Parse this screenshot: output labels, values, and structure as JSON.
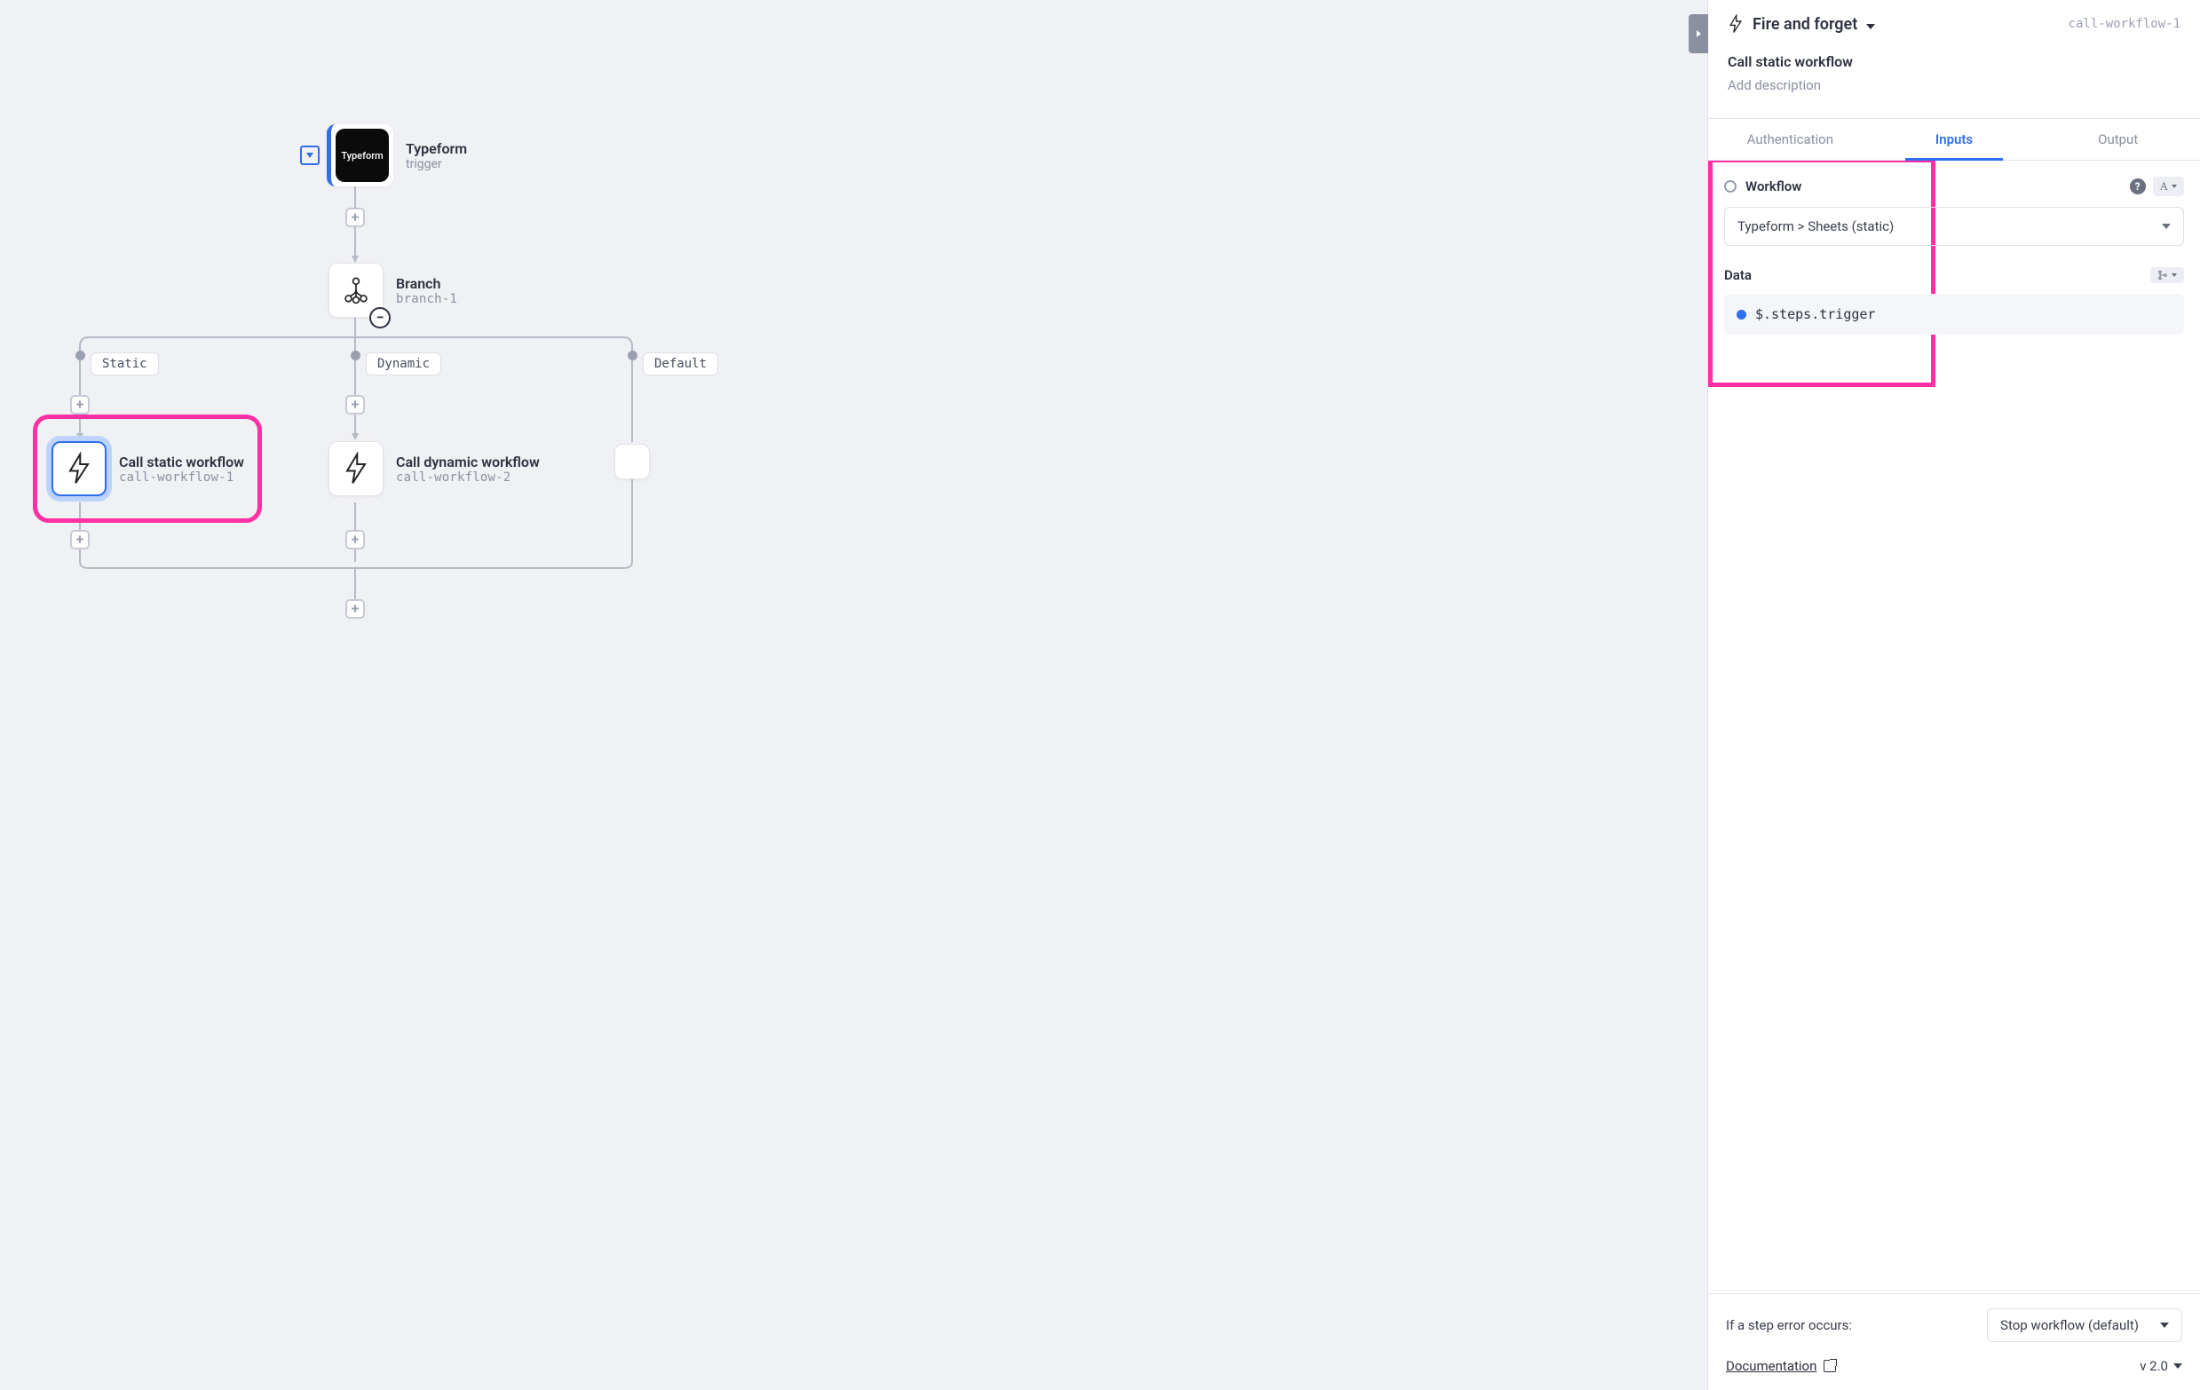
{
  "canvas": {
    "trigger": {
      "title": "Typeform",
      "sub": "trigger",
      "logo_text": "Typeform"
    },
    "branch": {
      "title": "Branch",
      "sub": "branch-1"
    },
    "branch_labels": {
      "static": "Static",
      "dynamic": "Dynamic",
      "default": "Default"
    },
    "call1": {
      "title": "Call static workflow",
      "sub": "call-workflow-1"
    },
    "call2": {
      "title": "Call dynamic workflow",
      "sub": "call-workflow-2"
    }
  },
  "panel": {
    "header_title": "Fire and forget",
    "header_id": "call-workflow-1",
    "subtitle1": "Call static workflow",
    "subtitle2": "Add description",
    "tabs": {
      "auth": "Authentication",
      "inputs": "Inputs",
      "output": "Output"
    },
    "fields": {
      "workflow": {
        "label": "Workflow",
        "value": "Typeform > Sheets (static)",
        "type_indicator": "A"
      },
      "data": {
        "label": "Data",
        "value": "$.steps.trigger"
      }
    },
    "footer": {
      "error_label": "If a step error occurs:",
      "error_value": "Stop workflow (default)",
      "doc_link": "Documentation",
      "version": "v 2.0"
    }
  }
}
